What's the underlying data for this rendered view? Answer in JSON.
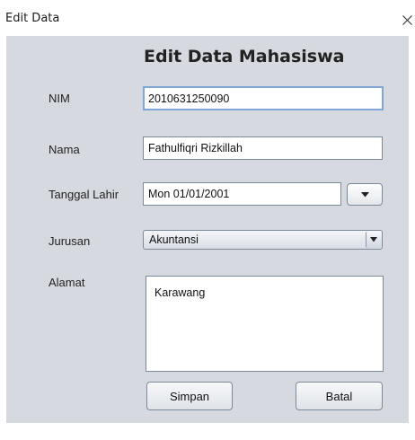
{
  "window": {
    "title": "Edit Data",
    "close_icon": "close-icon"
  },
  "form": {
    "heading": "Edit Data Mahasiswa",
    "nim": {
      "label": "NIM",
      "value": "2010631250090"
    },
    "nama": {
      "label": "Nama",
      "value": "Fathulfiqri Rizkillah"
    },
    "tanggal_lahir": {
      "label": "Tanggal Lahir",
      "value": "Mon 01/01/2001",
      "picker_icon": "chevron-down-icon"
    },
    "jurusan": {
      "label": "Jurusan",
      "value": "Akuntansi",
      "dropdown_icon": "chevron-down-icon"
    },
    "alamat": {
      "label": "Alamat",
      "value": "Karawang"
    }
  },
  "buttons": {
    "save_label": "Simpan",
    "cancel_label": "Batal"
  }
}
